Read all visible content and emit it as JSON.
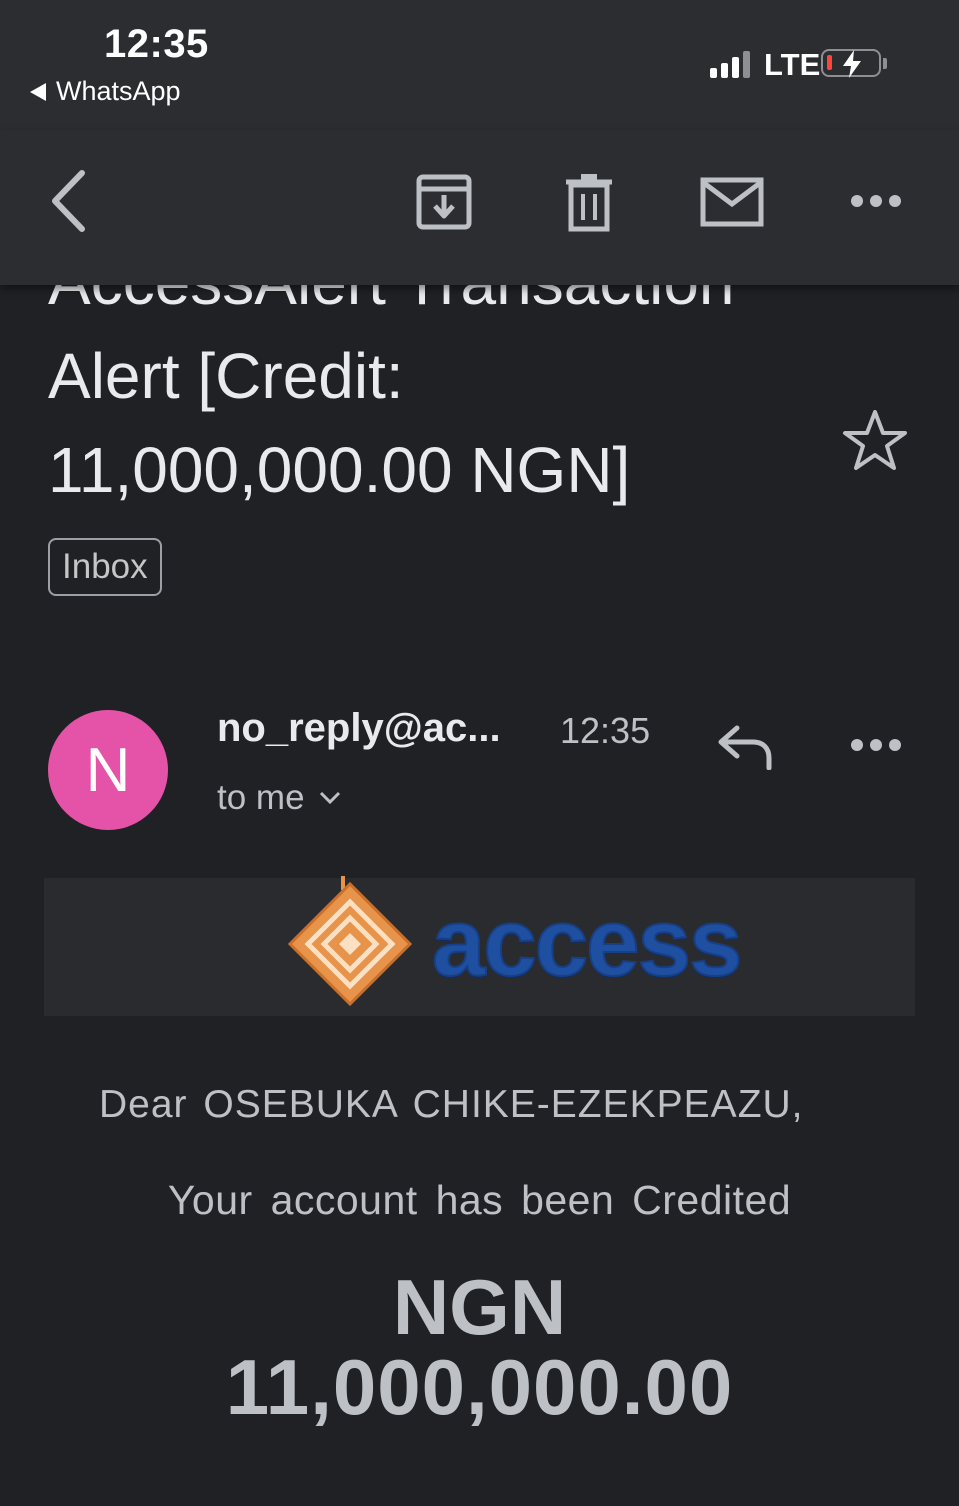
{
  "status_bar": {
    "time": "12:35",
    "back_app": "WhatsApp",
    "network": "LTE"
  },
  "toolbar": {
    "back_icon": "chevron-left-icon",
    "archive_icon": "archive-icon",
    "delete_icon": "trash-icon",
    "mark_unread_icon": "mail-icon",
    "more_icon": "more-horizontal-icon"
  },
  "email": {
    "subject_line1": "AccessAlert Transaction",
    "subject_line2": "Alert [Credit:",
    "subject_line3": "11,000,000.00 NGN]",
    "label": "Inbox",
    "sender_initial": "N",
    "sender": "no_reply@ac...",
    "time": "12:35",
    "recipient": "to me"
  },
  "body": {
    "brand": "access",
    "greeting": "Dear OSEBUKA CHIKE-EZEKPEAZU,",
    "message": "Your account has been Credited",
    "currency": "NGN",
    "amount": "11,000,000.00"
  },
  "colors": {
    "background": "#202124",
    "toolbar": "#2c2d31",
    "avatar": "#e453a8",
    "brand_blue": "#1e4fa0",
    "brand_orange": "#e8934a"
  }
}
